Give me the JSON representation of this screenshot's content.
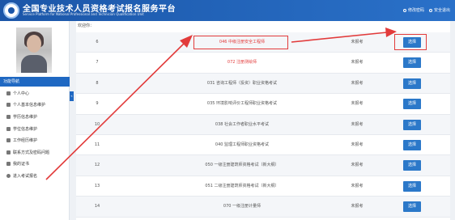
{
  "header": {
    "title": "全国专业技术人员资格考试报名服务平台",
    "subtitle": "Service Platform for National Professional and Technician Qualification Unit",
    "change_password": "修改密码",
    "logout": "安全退出"
  },
  "sidebar": {
    "section_title": "功能导航",
    "items": [
      {
        "label": "个人中心",
        "icon": "home-icon"
      },
      {
        "label": "个人基本信息维护",
        "icon": "user-icon"
      },
      {
        "label": "学历信息维护",
        "icon": "graduation-icon"
      },
      {
        "label": "学位信息维护",
        "icon": "graduation-icon"
      },
      {
        "label": "工作经历维护",
        "icon": "briefcase-icon"
      },
      {
        "label": "联系方式及密码问题",
        "icon": "phone-icon"
      },
      {
        "label": "我的证书",
        "icon": "certificate-icon"
      },
      {
        "label": "进入考试报名",
        "icon": "arrow-right-icon"
      }
    ],
    "collapse_toggle": "«"
  },
  "main": {
    "welcome": "欢迎你：",
    "rows": [
      {
        "num": "6",
        "name": "046 中级注册安全工程师",
        "status": "未报考",
        "button": "选择",
        "highlight": true,
        "red": true
      },
      {
        "num": "7",
        "name": "072 注册测绘师",
        "status": "未报考",
        "button": "选择",
        "highlight": false,
        "red": true
      },
      {
        "num": "8",
        "name": "031 咨询工程师（投资）职业资格考试",
        "status": "未报考",
        "button": "选择",
        "highlight": false,
        "red": false
      },
      {
        "num": "9",
        "name": "035 环境影响评价工程师职业资格考试",
        "status": "未报考",
        "button": "选择",
        "highlight": false,
        "red": false
      },
      {
        "num": "10",
        "name": "038 社会工作者职业水平考试",
        "status": "未报考",
        "button": "选择",
        "highlight": false,
        "red": false
      },
      {
        "num": "11",
        "name": "040 监理工程师职业资格考试",
        "status": "未报考",
        "button": "选择",
        "highlight": false,
        "red": false
      },
      {
        "num": "12",
        "name": "050 一级注册建筑师资格考试（新大纲）",
        "status": "未报考",
        "button": "选择",
        "highlight": false,
        "red": false
      },
      {
        "num": "13",
        "name": "051 二级注册建筑师资格考试（新大纲）",
        "status": "未报考",
        "button": "选择",
        "highlight": false,
        "red": false
      },
      {
        "num": "14",
        "name": "070 一级注册计量师",
        "status": "未报考",
        "button": "选择",
        "highlight": false,
        "red": false
      }
    ]
  },
  "colors": {
    "header_bg": "#1b56a8",
    "button_bg": "#2b78c9",
    "annotation_red": "#e23b3b"
  }
}
